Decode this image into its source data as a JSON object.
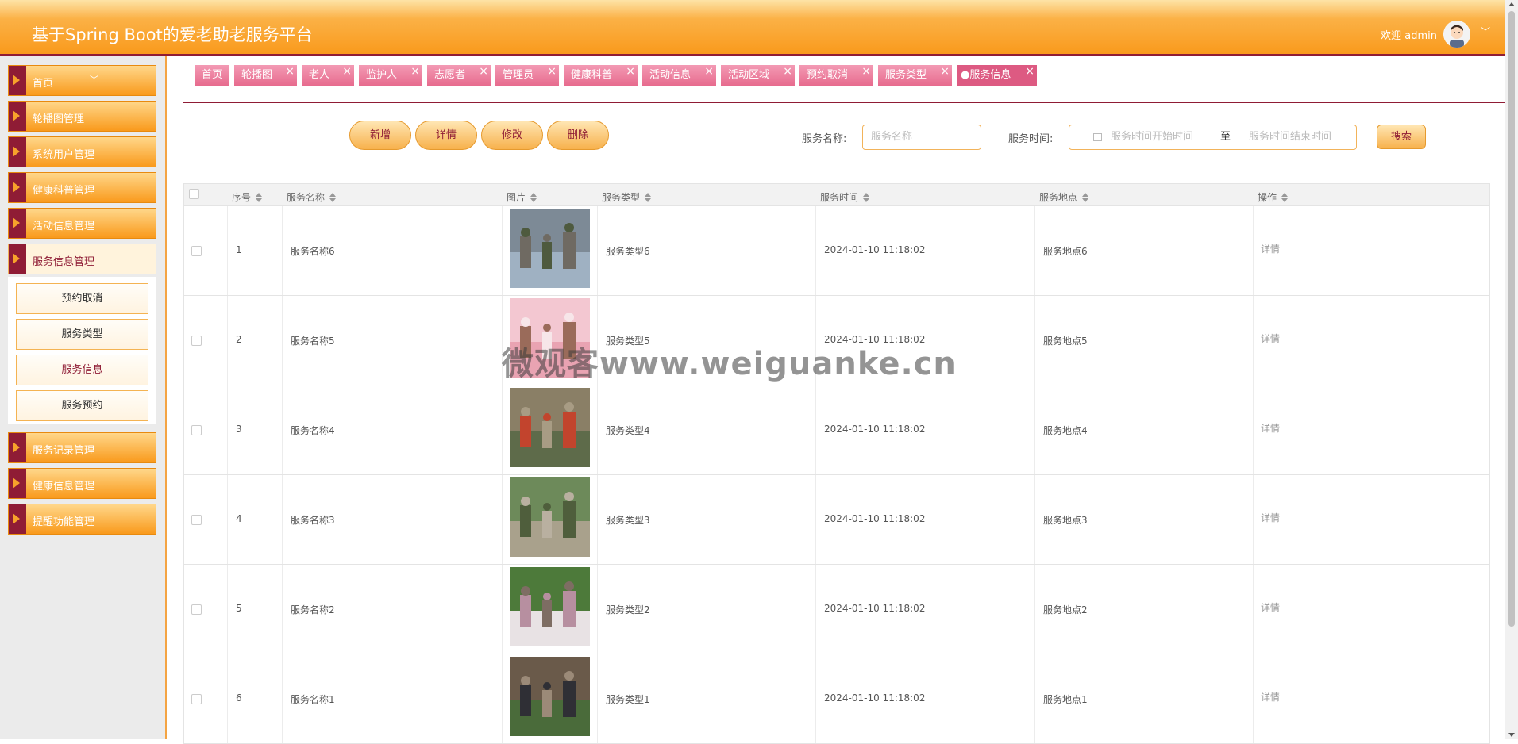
{
  "app": {
    "title": "基于Spring Boot的爱老助老服务平台",
    "welcome": "欢迎 admin"
  },
  "sidebar": {
    "items": [
      {
        "label": "首页"
      },
      {
        "label": "轮播图管理"
      },
      {
        "label": "系统用户管理"
      },
      {
        "label": "健康科普管理"
      },
      {
        "label": "活动信息管理"
      },
      {
        "label": "服务信息管理"
      },
      {
        "label": "服务记录管理"
      },
      {
        "label": "健康信息管理"
      },
      {
        "label": "提醒功能管理"
      }
    ],
    "submenu": [
      {
        "label": "预约取消"
      },
      {
        "label": "服务类型"
      },
      {
        "label": "服务信息"
      },
      {
        "label": "服务预约"
      }
    ]
  },
  "tabs": [
    {
      "label": "首页"
    },
    {
      "label": "轮播图"
    },
    {
      "label": "老人"
    },
    {
      "label": "监护人"
    },
    {
      "label": "志愿者"
    },
    {
      "label": "管理员"
    },
    {
      "label": "健康科普"
    },
    {
      "label": "活动信息"
    },
    {
      "label": "活动区域"
    },
    {
      "label": "预约取消"
    },
    {
      "label": "服务类型"
    },
    {
      "label": "●服务信息"
    }
  ],
  "actions": {
    "add": "新增",
    "detail": "详情",
    "edit": "修改",
    "delete": "删除"
  },
  "filters": {
    "name_label": "服务名称:",
    "name_placeholder": "服务名称",
    "time_label": "服务时间:",
    "start_placeholder": "服务时间开始时间",
    "to": "至",
    "end_placeholder": "服务时间结束时间",
    "search": "搜索"
  },
  "table": {
    "headers": [
      "序号",
      "服务名称",
      "图片",
      "服务类型",
      "服务时间",
      "服务地点",
      "操作"
    ],
    "rows": [
      {
        "no": "1",
        "name": "服务名称6",
        "type": "服务类型6",
        "time": "2024-01-10 11:18:02",
        "place": "服务地点6",
        "op": "详情"
      },
      {
        "no": "2",
        "name": "服务名称5",
        "type": "服务类型5",
        "time": "2024-01-10 11:18:02",
        "place": "服务地点5",
        "op": "详情"
      },
      {
        "no": "3",
        "name": "服务名称4",
        "type": "服务类型4",
        "time": "2024-01-10 11:18:02",
        "place": "服务地点4",
        "op": "详情"
      },
      {
        "no": "4",
        "name": "服务名称3",
        "type": "服务类型3",
        "time": "2024-01-10 11:18:02",
        "place": "服务地点3",
        "op": "详情"
      },
      {
        "no": "5",
        "name": "服务名称2",
        "type": "服务类型2",
        "time": "2024-01-10 11:18:02",
        "place": "服务地点2",
        "op": "详情"
      },
      {
        "no": "6",
        "name": "服务名称1",
        "type": "服务类型1",
        "time": "2024-01-10 11:18:02",
        "place": "服务地点1",
        "op": "详情"
      }
    ]
  },
  "watermark": "微观客www.weiguanke.cn",
  "colors": {
    "brand_orange": "#f99a1c",
    "brand_maroon": "#8f1c35",
    "tab_pink": "#e76b8e"
  }
}
